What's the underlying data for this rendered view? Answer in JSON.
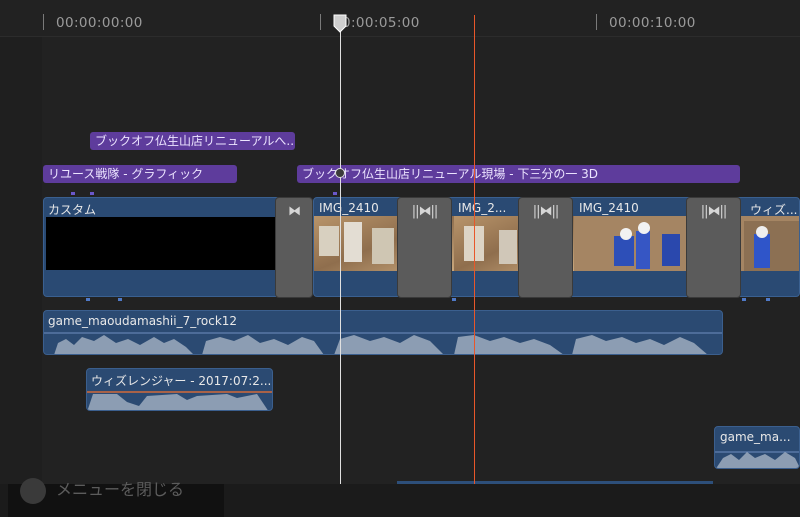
{
  "ruler": {
    "tc_0": "00:00:00:00",
    "tc_5": "00:00:05:00",
    "tc_10": "00:00:10:00"
  },
  "titles": {
    "title1": "ブックオフ仏生山店リニューアルへ...",
    "title2": "リユース戦隊 - グラフィック",
    "title3": "ブックオフ仏生山店リニューアル現場 - 下三分の一 3D"
  },
  "primary": {
    "custom": "カスタム",
    "img1": "IMG_2410",
    "img2": "IMG_2...",
    "img3": "IMG_2410",
    "img4": "ウィズ..."
  },
  "audio": {
    "music": "game_maoudamashii_7_rock12",
    "wiz": "ウィズレンジャー - 2017:07:2...",
    "game2": "game_ma..."
  },
  "bottom": {
    "close_menu": "メニューを閉じる"
  },
  "colors": {
    "title_clip": "#5e3c9c",
    "video_clip": "#2a4a73",
    "audio_clip": "#2b4a72",
    "waveform": "#8c9db3",
    "playhead": "#e0e0e0",
    "skimmer": "#e8572a"
  }
}
